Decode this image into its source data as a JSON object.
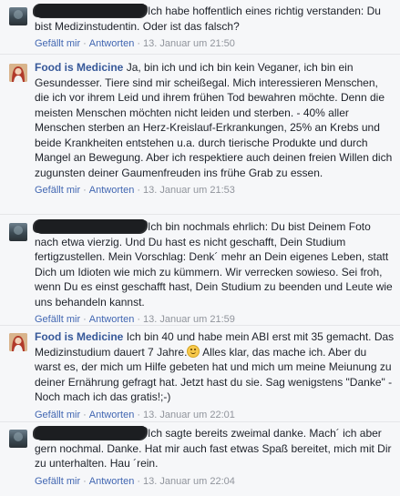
{
  "comments": [
    {
      "author": "",
      "redacted": true,
      "text": "Ich habe hoffentlich eines richtig verstanden: Du bist Medizinstudentin. Oder ist das falsch?",
      "like_label": "Gefällt mir",
      "reply_label": "Antworten",
      "timestamp": "13. Januar um 21:50"
    },
    {
      "author": "Food is Medicine",
      "redacted": false,
      "text": "Ja, bin ich und ich bin kein Veganer, ich bin ein Gesundesser. Tiere sind mir scheißegal. Mich interessieren Menschen, die ich vor ihrem Leid und ihrem frühen Tod bewahren möchte. Denn die meisten Menschen möchten nicht leiden und sterben. - 40% aller Menschen sterben an Herz-Kreislauf-Erkrankungen, 25% an Krebs und beide Krankheiten entstehen u.a. durch tierische Produkte und durch Mangel an Bewegung. Aber ich respektiere auch deinen freien Willen dich zugunsten deiner Gaumenfreuden ins frühe Grab zu essen.",
      "like_label": "Gefällt mir",
      "reply_label": "Antworten",
      "timestamp": "13. Januar um 21:53"
    },
    {
      "author": "",
      "redacted": true,
      "text": "Ich bin nochmals ehrlich: Du bist Deinem Foto nach etwa vierzig. Und Du hast es nicht geschafft, Dein Studium fertigzustellen. Mein Vorschlag: Denk´ mehr an Dein eigenes Leben, statt Dich um Idioten wie mich zu kümmern. Wir verrecken sowieso. Sei froh, wenn Du es einst geschafft hast, Dein Studium zu beenden und Leute wie uns behandeln kannst.",
      "like_label": "Gefällt mir",
      "reply_label": "Antworten",
      "timestamp": "13. Januar um 21:59"
    },
    {
      "author": "Food is Medicine",
      "redacted": false,
      "text_before": "Ich bin 40 und habe mein ABI erst mit 35 gemacht. Das Medizinstudium dauert 7 Jahre.",
      "text_after": " Alles klar, das mache ich. Aber du warst es, der mich um Hilfe gebeten hat und mich um meine Meiunung zu deiner Ernährung gefragt hat. Jetzt hast du sie. Sag wenigstens \"Danke\" - Noch mach ich das gratis!;-)",
      "like_label": "Gefällt mir",
      "reply_label": "Antworten",
      "timestamp": "13. Januar um 22:01"
    },
    {
      "author": "",
      "redacted": true,
      "text": "Ich sagte bereits zweimal danke. Mach´ ich aber gern nochmal. Danke. Hat mir auch fast etwas Spaß bereitet, mich mit Dir zu unterhalten. Hau ´rein.",
      "like_label": "Gefällt mir",
      "reply_label": "Antworten",
      "timestamp": "13. Januar um 22:04"
    }
  ],
  "icons": {
    "avatar_anon": "user-avatar-icon",
    "avatar_page": "page-avatar-icon",
    "smiley": "smiley-emoji-icon"
  },
  "colors": {
    "author_link": "#365899",
    "action_link": "#4267b2",
    "meta_text": "#90949c",
    "background": "#f6f7f9"
  }
}
